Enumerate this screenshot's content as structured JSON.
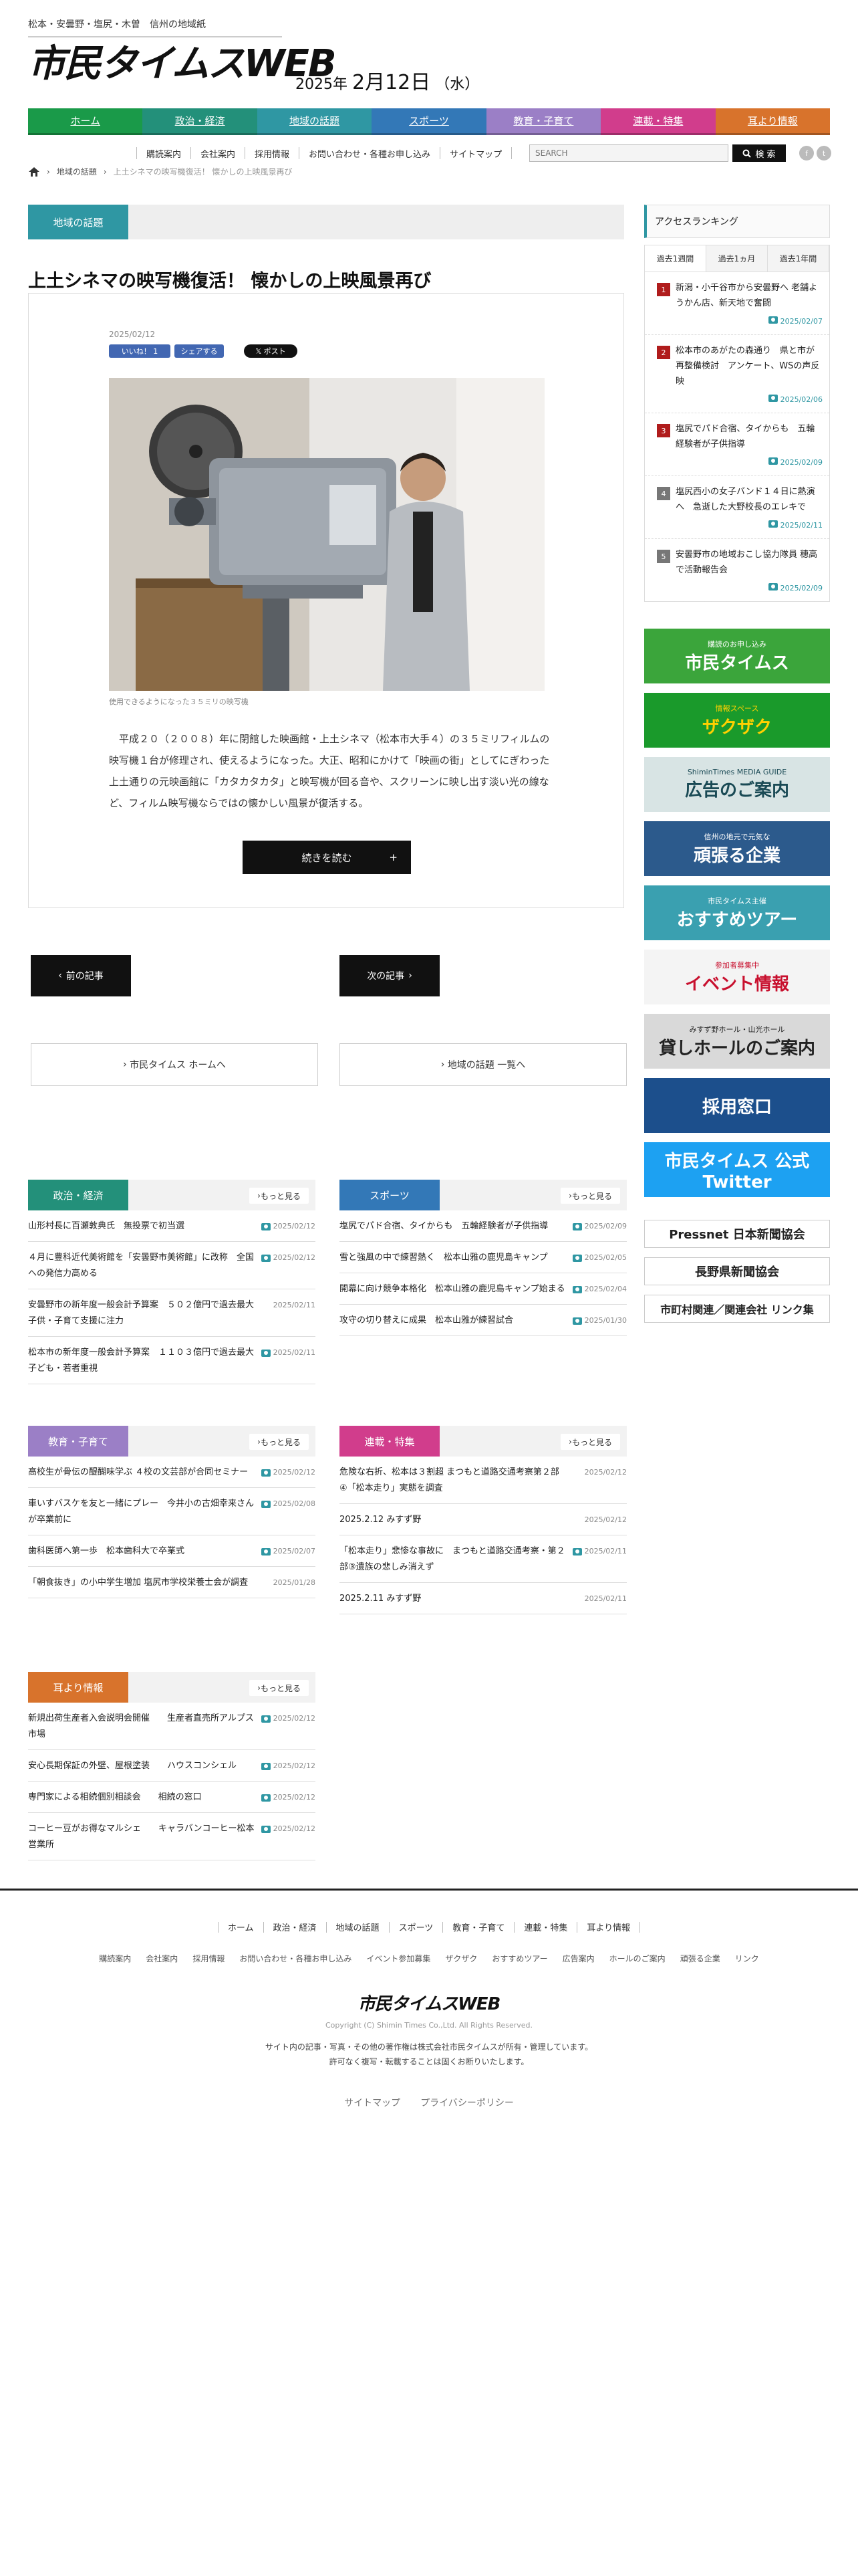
{
  "header": {
    "tagline": "松本・安曇野・塩尻・木曽　信州の地域紙",
    "logo": "市民タイムスWEB",
    "date_prefix": "2025年",
    "date_main": "2月12日",
    "date_weekday": "（水）"
  },
  "global_nav": [
    {
      "label": "ホーム",
      "color": "#1a9a49"
    },
    {
      "label": "政治・経済",
      "color": "#23907a"
    },
    {
      "label": "地域の話題",
      "color": "#2f97a3"
    },
    {
      "label": "スポーツ",
      "color": "#3378b7"
    },
    {
      "label": "教育・子育て",
      "color": "#9b7fc6"
    },
    {
      "label": "連載・特集",
      "color": "#d13d8c"
    },
    {
      "label": "耳より情報",
      "color": "#d8732c"
    }
  ],
  "sub_nav": [
    "購読案内",
    "会社案内",
    "採用情報",
    "お問い合わせ・各種お申し込み",
    "サイトマップ"
  ],
  "search": {
    "placeholder": "SEARCH",
    "button": "検 索"
  },
  "breadcrumb": {
    "category": "地域の話題",
    "current": "上土シネマの映写機復活！ 懐かしの上映風景再び"
  },
  "article": {
    "category": "地域の話題",
    "title": "上土シネマの映写機復活！ 懐かしの上映風景再び",
    "date": "2025/02/12",
    "share": {
      "like": "いいね！ 1",
      "share": "シェアする",
      "post": "ポスト"
    },
    "caption": "使用できるようになった３５ミリの映写機",
    "body": "平成２０（２００８）年に閉館した映画館・上土シネマ（松本市大手４）の３５ミリフィルムの映写機１台が修理され、使えるようになった。大正、昭和にかけて「映画の街」としてにぎわった上土通りの元映画館に「カタカタカタ」と映写機が回る音や、スクリーンに映し出す淡い光の線など、フィルム映写機ならではの懐かしい風景が復活する。",
    "read_more": "続きを読む"
  },
  "pager": {
    "prev": "前の記事",
    "next": "次の記事"
  },
  "links": {
    "home": "市民タイムス ホームへ",
    "list": "地域の話題 一覧へ"
  },
  "more_label": "もっと見る",
  "sections": [
    {
      "name": "政治・経済",
      "color": "#23907a",
      "items": [
        {
          "title": "山形村長に百瀬敦典氏　無投票で初当選",
          "date": "2025/02/12",
          "cam": true
        },
        {
          "title": "４月に豊科近代美術館を「安曇野市美術館」に改称　全国への発信力高める",
          "date": "2025/02/12",
          "cam": true
        },
        {
          "title": "安曇野市の新年度一般会計予算案　５０２億円で過去最大　子供・子育て支援に注力",
          "date": "2025/02/11",
          "cam": false
        },
        {
          "title": "松本市の新年度一般会計予算案　１１０３億円で過去最大　子ども・若者重視",
          "date": "2025/02/11",
          "cam": true
        }
      ]
    },
    {
      "name": "スポーツ",
      "color": "#3378b7",
      "items": [
        {
          "title": "塩尻でパド合宿、タイからも　五輪経験者が子供指導",
          "date": "2025/02/09",
          "cam": true
        },
        {
          "title": "雪と強風の中で練習熱く　松本山雅の鹿児島キャンプ",
          "date": "2025/02/05",
          "cam": true
        },
        {
          "title": "開幕に向け競争本格化　松本山雅の鹿児島キャンプ始まる",
          "date": "2025/02/04",
          "cam": true
        },
        {
          "title": "攻守の切り替えに成果　松本山雅が練習試合",
          "date": "2025/01/30",
          "cam": true
        }
      ]
    },
    {
      "name": "教育・子育て",
      "color": "#9b7fc6",
      "items": [
        {
          "title": "高校生が骨伝の醍醐味学ぶ ４校の文芸部が合同セミナー",
          "date": "2025/02/12",
          "cam": true
        },
        {
          "title": "車いすバスケを友と一緒にプレー　今井小の古畑幸来さんが卒業前に",
          "date": "2025/02/08",
          "cam": true
        },
        {
          "title": "歯科医師へ第一歩　松本歯科大で卒業式",
          "date": "2025/02/07",
          "cam": true
        },
        {
          "title": "「朝食抜き」の小中学生増加 塩尻市学校栄養士会が調査",
          "date": "2025/01/28",
          "cam": false
        }
      ]
    },
    {
      "name": "連載・特集",
      "color": "#d13d8c",
      "items": [
        {
          "title": "危険な右折、松本は３割超 まつもと道路交通考察第２部④「松本走り」実態を調査",
          "date": "2025/02/12",
          "cam": false
        },
        {
          "title": "2025.2.12 みすず野",
          "date": "2025/02/12",
          "cam": false
        },
        {
          "title": "「松本走り」悲惨な事故に　まつもと道路交通考察・第２部③遺族の悲しみ消えず",
          "date": "2025/02/11",
          "cam": true
        },
        {
          "title": "2025.2.11 みすず野",
          "date": "2025/02/11",
          "cam": false
        }
      ]
    },
    {
      "name": "耳より情報",
      "color": "#d8732c",
      "items": [
        {
          "title": "新規出荷生産者入会説明会開催　　生産者直売所アルプス市場",
          "date": "2025/02/12",
          "cam": true
        },
        {
          "title": "安心長期保証の外壁、屋根塗装　　ハウスコンシェル",
          "date": "2025/02/12",
          "cam": true
        },
        {
          "title": "専門家による相続個別相談会　　相続の窓口",
          "date": "2025/02/12",
          "cam": true
        },
        {
          "title": "コーヒー豆がお得なマルシェ　　キャラバンコーヒー松本営業所",
          "date": "2025/02/12",
          "cam": true
        }
      ]
    }
  ],
  "ranking": {
    "heading": "アクセスランキング",
    "tabs": [
      "過去1週間",
      "過去1ヵ月",
      "過去1年間"
    ],
    "items": [
      {
        "rank": "1",
        "title": "新潟・小千谷市から安曇野へ 老舗ようかん店、新天地で奮闘",
        "date": "2025/02/07",
        "color": "#b01c1c"
      },
      {
        "rank": "2",
        "title": "松本市のあがたの森通り　県と市が再整備検討　アンケート、WSの声反映",
        "date": "2025/02/06",
        "color": "#b01c1c"
      },
      {
        "rank": "3",
        "title": "塩尻でパド合宿、タイからも　五輪経験者が子供指導",
        "date": "2025/02/09",
        "color": "#b01c1c"
      },
      {
        "rank": "4",
        "title": "塩尻西小の女子バンド１４日に熱演へ　急逝した大野校長のエレキで",
        "date": "2025/02/11",
        "color": "#777"
      },
      {
        "rank": "5",
        "title": "安曇野市の地域おこし協力隊員 穂高で活動報告会",
        "date": "2025/02/09",
        "color": "#777"
      }
    ]
  },
  "banners": [
    {
      "text": "市民タイムス",
      "sub": "購読のお申し込み",
      "bg": "#3ba53b",
      "fg": "#fff"
    },
    {
      "text": "ザクザク",
      "sub": "情報スペース",
      "bg": "#1a9a2b",
      "fg": "#ffd000"
    },
    {
      "text": "広告のご案内",
      "sub": "ShiminTimes MEDIA GUIDE",
      "bg": "#d8e4e4",
      "fg": "#1a4a55"
    },
    {
      "text": "頑張る企業",
      "sub": "信州の地元で元気な",
      "bg": "#2c5a8c",
      "fg": "#fff"
    },
    {
      "text": "おすすめツアー",
      "sub": "市民タイムス主催",
      "bg": "#3aa0b0",
      "fg": "#fff"
    },
    {
      "text": "イベント情報",
      "sub": "参加者募集中",
      "bg": "#f4f4f4",
      "fg": "#c8102e"
    },
    {
      "text": "貸しホールのご案内",
      "sub": "みすず野ホール・山光ホール",
      "bg": "#d9d9d9",
      "fg": "#222"
    },
    {
      "text": "採用窓口",
      "sub": "",
      "bg": "#1c4f8c",
      "fg": "#fff"
    },
    {
      "text": "市民タイムス 公式Twitter",
      "sub": "",
      "bg": "#1da1f2",
      "fg": "#fff"
    }
  ],
  "small_banners": [
    {
      "text": "Pressnet 日本新聞協会"
    },
    {
      "text": "長野県新聞協会"
    },
    {
      "text": "市町村関連／関連会社 リンク集"
    }
  ],
  "footer": {
    "nav": [
      "ホーム",
      "政治・経済",
      "地域の話題",
      "スポーツ",
      "教育・子育て",
      "連載・特集",
      "耳より情報"
    ],
    "nav2": [
      "購読案内",
      "会社案内",
      "採用情報",
      "お問い合わせ・各種お申し込み",
      "イベント参加募集",
      "ザクザク",
      "おすすめツアー",
      "広告案内",
      "ホールのご案内",
      "頑張る企業",
      "リンク"
    ],
    "logo": "市民タイムスWEB",
    "copyright": "Copyright (C) Shimin Times Co.,Ltd. All Rights Reserved.",
    "note1": "サイト内の記事・写真・その他の著作権は株式会社市民タイムスが所有・管理しています。",
    "note2": "許可なく複写・転載することは固くお断りいたします。",
    "links": [
      "サイトマップ",
      "プライバシーポリシー"
    ]
  }
}
